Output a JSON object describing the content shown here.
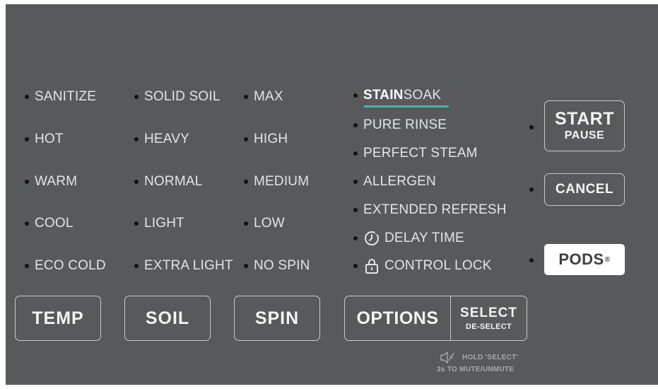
{
  "columns": {
    "temp": [
      "SANITIZE",
      "HOT",
      "WARM",
      "COOL",
      "ECO COLD"
    ],
    "soil": [
      "SOLID SOIL",
      "HEAVY",
      "NORMAL",
      "LIGHT",
      "EXTRA LIGHT"
    ],
    "spin": [
      "MAX",
      "HIGH",
      "MEDIUM",
      "LOW",
      "NO SPIN"
    ]
  },
  "options": {
    "stain_soak": {
      "stain": "STAIN",
      "soak": "SOAK"
    },
    "pure_rinse": "PURE RINSE",
    "perfect_steam": "PERFECT STEAM",
    "allergen": "ALLERGEN",
    "extended_refresh": "EXTENDED REFRESH",
    "delay_time": "DELAY TIME",
    "control_lock": "CONTROL LOCK"
  },
  "buttons": {
    "temp": "TEMP",
    "soil": "SOIL",
    "spin": "SPIN",
    "options": "OPTIONS",
    "select": "SELECT",
    "deselect": "DE-SELECT",
    "start": "START",
    "pause": "PAUSE",
    "cancel": "CANCEL",
    "pods": "PODS",
    "pods_mark": "®"
  },
  "mute_hint": {
    "line1": "HOLD 'SELECT'",
    "line2": "3s TO MUTE/UNMUTE"
  },
  "colors": {
    "panel": "#58595b",
    "text": "#e4e4e4",
    "indicator_dot": "#121212",
    "stain_soak_accent": "#43b5b1",
    "pods_button_bg": "#ffffff"
  },
  "icons": {
    "delay_time": "clock-icon",
    "control_lock": "lock-icon",
    "mute": "speaker-mute-icon"
  }
}
